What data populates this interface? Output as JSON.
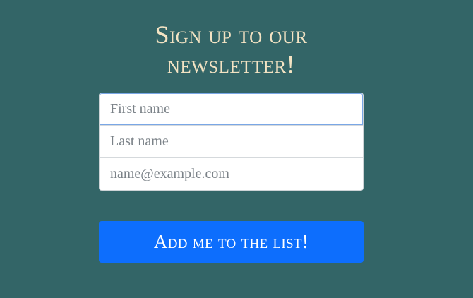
{
  "newsletter": {
    "title_line1": "Sign up to our",
    "title_line2": "newsletter!",
    "fields": {
      "first_name_placeholder": "First name",
      "last_name_placeholder": "Last name",
      "email_placeholder": "name@example.com"
    },
    "submit_label": "Add me to the list!"
  },
  "colors": {
    "background": "#336567",
    "title": "#f3e3c3",
    "button": "#0d6efd",
    "focus_ring": "#7aa7e6"
  }
}
